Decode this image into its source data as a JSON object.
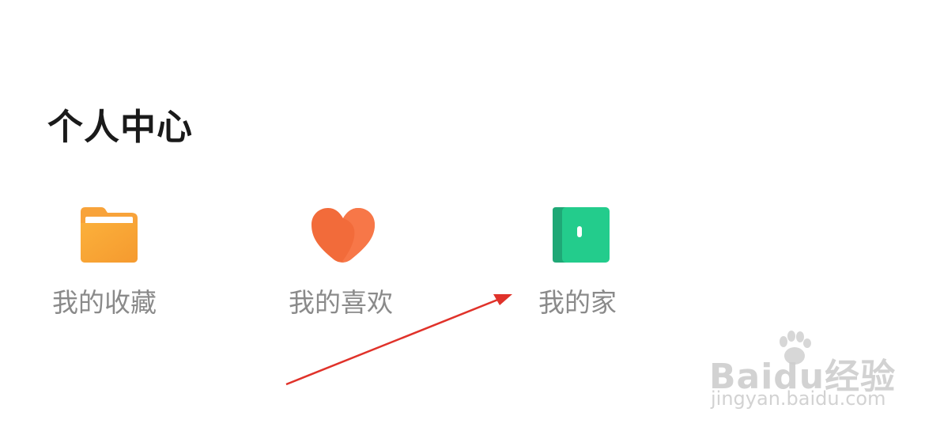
{
  "section": {
    "title": "个人中心"
  },
  "items": [
    {
      "label": "我的收藏",
      "icon": "folder-icon",
      "color": "#F7A535"
    },
    {
      "label": "我的喜欢",
      "icon": "heart-icon",
      "color": "#F56A3F"
    },
    {
      "label": "我的家",
      "icon": "door-icon",
      "color": "#22C98A"
    }
  ],
  "annotation": {
    "arrow_color": "#E0322A"
  },
  "watermark": {
    "brand_text": "Baidu经验",
    "url": "jingyan.baidu.com"
  }
}
